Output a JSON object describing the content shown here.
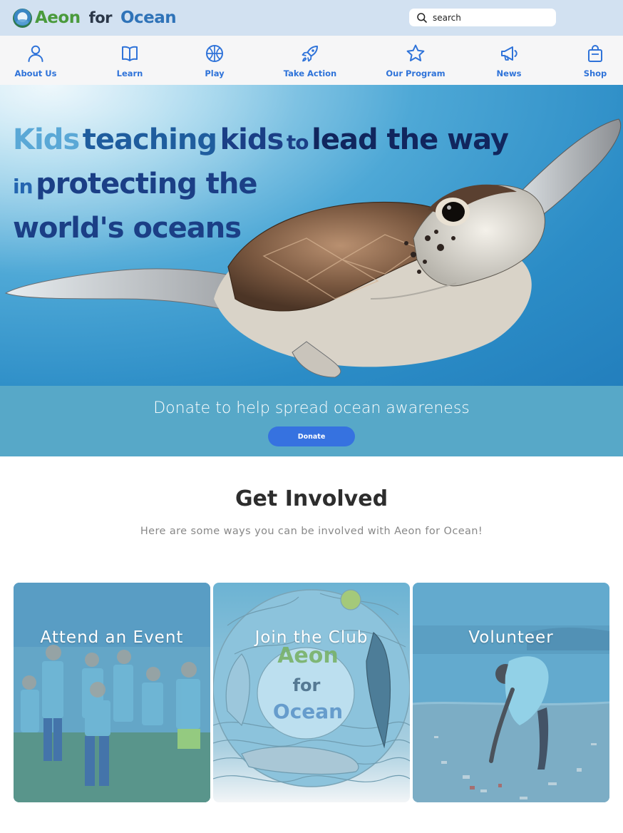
{
  "brand": {
    "logo_aeon": "Aeon",
    "logo_for": "for",
    "logo_ocean": "Ocean"
  },
  "search": {
    "placeholder": "search",
    "icon": "search-icon"
  },
  "nav": {
    "items": [
      {
        "label": "About Us",
        "icon": "user-icon"
      },
      {
        "label": "Learn",
        "icon": "book-icon"
      },
      {
        "label": "Play",
        "icon": "basketball-icon"
      },
      {
        "label": "Take Action",
        "icon": "rocket-icon"
      },
      {
        "label": "Our Program",
        "icon": "star-icon"
      },
      {
        "label": "News",
        "icon": "megaphone-icon"
      },
      {
        "label": "Shop",
        "icon": "shopping-bag-icon"
      }
    ]
  },
  "hero": {
    "line1": {
      "a": "Kids",
      "b": "teaching",
      "c": "kids",
      "d": "to",
      "e": "lead the way"
    },
    "line2": {
      "a": "in",
      "b": "protecting the"
    },
    "line3": "world's oceans"
  },
  "donate": {
    "text": "Donate to help spread ocean awareness",
    "button": "Donate"
  },
  "get_involved": {
    "title": "Get Involved",
    "subtitle": "Here are some ways you can be involved with Aeon for Ocean!",
    "cards": [
      {
        "label": "Attend an Event"
      },
      {
        "label": "Join the Club",
        "art_aeon": "Aeon",
        "art_for": "for",
        "art_ocean": "Ocean"
      },
      {
        "label": "Volunteer"
      }
    ]
  },
  "colors": {
    "topbar": "#d2e1f1",
    "nav_accent": "#2f73d9",
    "donate_band": "#57a8c8",
    "donate_button": "#3672e0"
  }
}
